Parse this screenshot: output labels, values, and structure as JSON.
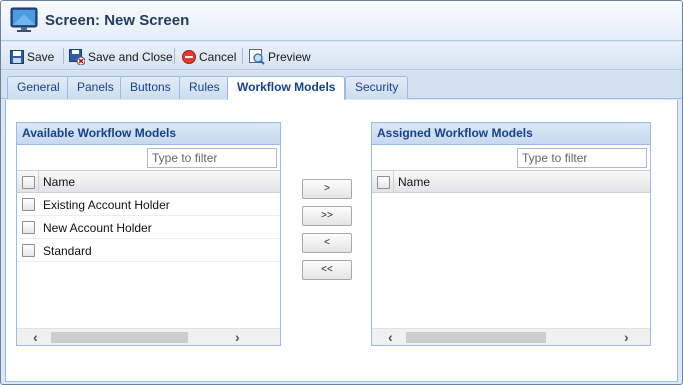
{
  "window": {
    "title": "Screen: New Screen"
  },
  "toolbar": {
    "save_label": "Save",
    "save_close_label": "Save and Close",
    "cancel_label": "Cancel",
    "preview_label": "Preview"
  },
  "tabs": [
    {
      "label": "General"
    },
    {
      "label": "Panels"
    },
    {
      "label": "Buttons"
    },
    {
      "label": "Rules"
    },
    {
      "label": "Workflow Models",
      "active": true
    },
    {
      "label": "Security"
    }
  ],
  "available": {
    "header": "Available Workflow Models",
    "filter_placeholder": "Type to filter",
    "column_name": "Name",
    "rows": [
      "Existing Account Holder",
      "New Account Holder",
      "Standard"
    ]
  },
  "assigned": {
    "header": "Assigned Workflow Models",
    "filter_placeholder": "Type to filter",
    "column_name": "Name",
    "rows": []
  },
  "move_buttons": {
    "add_one": ">",
    "add_all": ">>",
    "remove_one": "<",
    "remove_all": "<<"
  },
  "colors": {
    "accent": "#15428b",
    "border": "#99bbe8",
    "panel_header": "#c7d9ef"
  },
  "icons": {
    "app": "monitor-icon",
    "save": "floppy-disk-icon",
    "save_close": "save-close-icon",
    "cancel": "cancel-circle-icon",
    "preview": "preview-icon"
  }
}
